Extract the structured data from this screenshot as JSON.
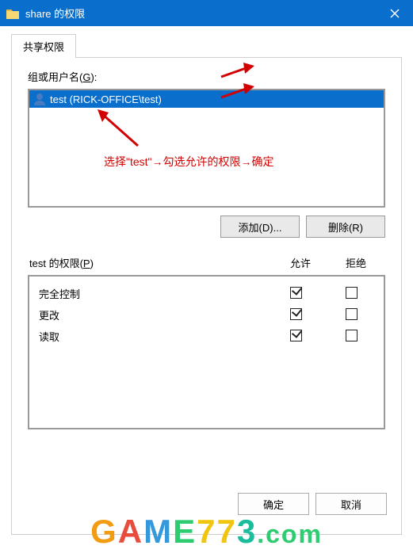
{
  "window": {
    "title": "share 的权限",
    "close_glyph": "×"
  },
  "tab": {
    "label": "共享权限"
  },
  "groups_label_pre": "组或用户名(",
  "groups_label_u": "G",
  "groups_label_post": "):",
  "list": {
    "items": [
      {
        "display": "test (RICK-OFFICE\\test)"
      }
    ]
  },
  "annotation": "选择\"test\"→勾选允许的权限→确定",
  "buttons": {
    "add": "添加(D)...",
    "remove": "删除(R)"
  },
  "perm_label_pre": "test 的权限(",
  "perm_label_u": "P",
  "perm_label_post": ")",
  "cols": {
    "allow": "允许",
    "deny": "拒绝"
  },
  "perms": [
    {
      "name": "完全控制",
      "allow": true,
      "deny": false
    },
    {
      "name": "更改",
      "allow": true,
      "deny": false
    },
    {
      "name": "读取",
      "allow": true,
      "deny": false
    }
  ],
  "dialog": {
    "ok": "确定",
    "cancel": "取消"
  },
  "watermark": "GAME773.com"
}
